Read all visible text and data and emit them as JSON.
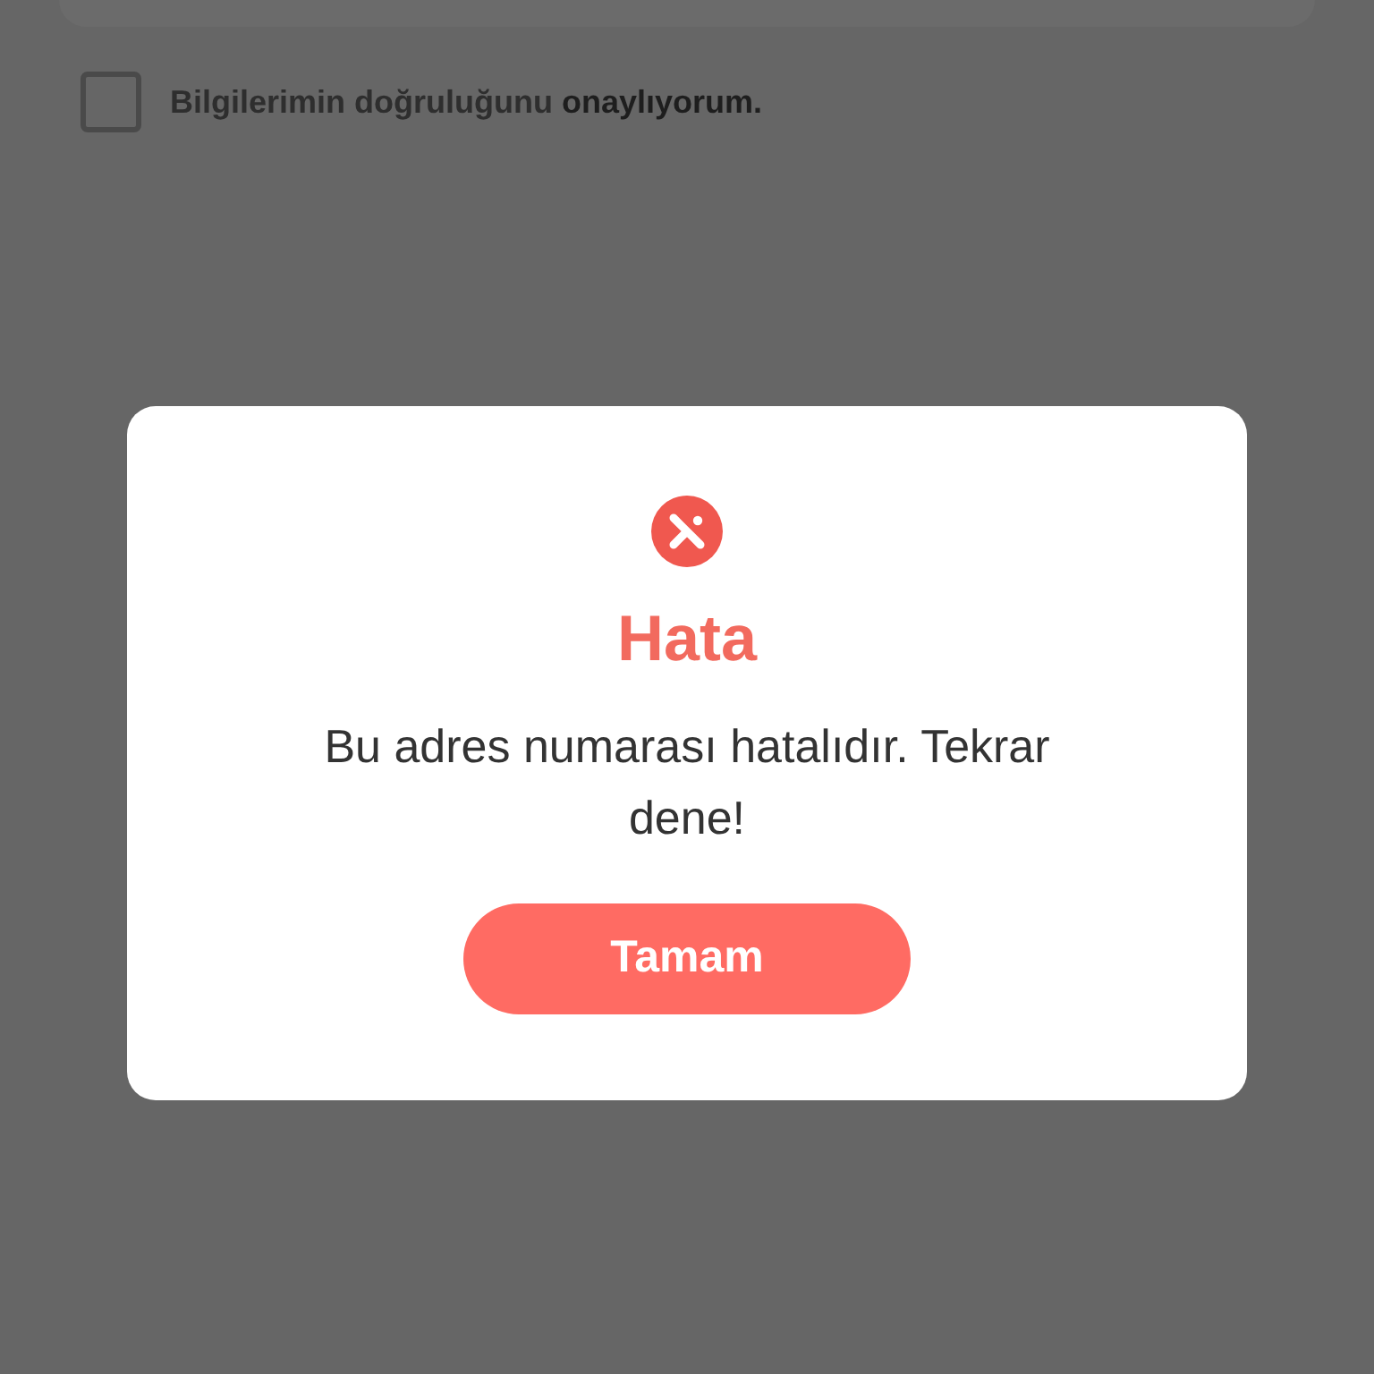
{
  "background": {
    "consent": {
      "label": "Bilgilerimin doğruluğunu **onaylıyorum.**",
      "checked": false
    }
  },
  "dialog": {
    "title": "Hata",
    "message": "Bu adres numarası hatalıdır. Tekrar dene!",
    "button": "Tamam"
  }
}
